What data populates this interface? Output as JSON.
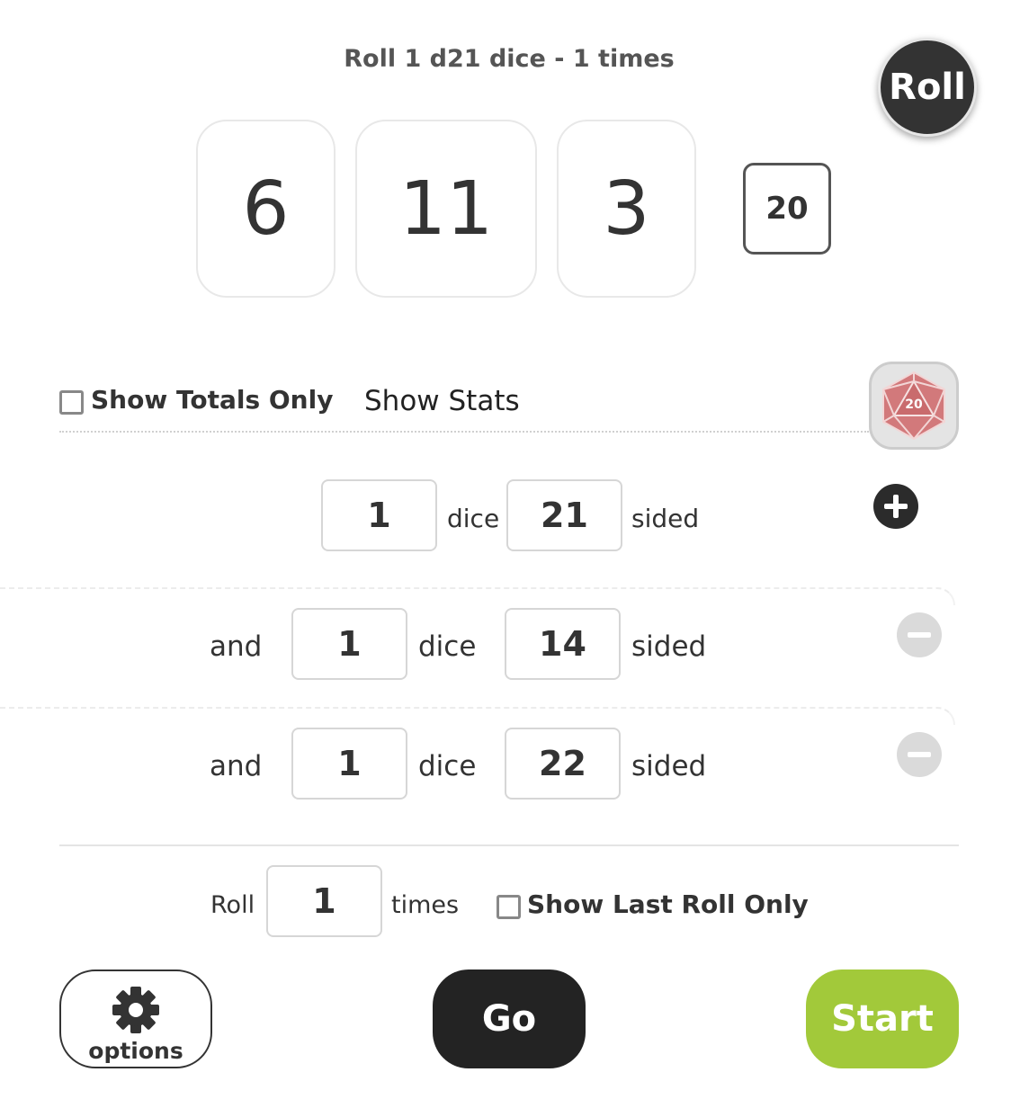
{
  "header": {
    "title": "Roll 1 d21 dice - 1 times",
    "roll_button_label": "Roll"
  },
  "results": {
    "values": [
      "6",
      "11",
      "3"
    ],
    "total": "20"
  },
  "toolbar": {
    "show_totals_only_label": "Show Totals Only",
    "show_totals_only_checked": false,
    "show_stats_label": "Show Stats",
    "dice_icon_number": "20",
    "dice_icon_color": "#d2797b"
  },
  "dice_rows": [
    {
      "prefix": "",
      "count": "1",
      "dice_word": "dice",
      "sides": "21",
      "sided_word": "sided",
      "action": "add"
    },
    {
      "prefix": "and",
      "count": "1",
      "dice_word": "dice",
      "sides": "14",
      "sided_word": "sided",
      "action": "remove"
    },
    {
      "prefix": "and",
      "count": "1",
      "dice_word": "dice",
      "sides": "22",
      "sided_word": "sided",
      "action": "remove"
    }
  ],
  "repeat": {
    "roll_word": "Roll",
    "times_value": "1",
    "times_word": "times",
    "show_last_roll_only_label": "Show Last Roll Only",
    "show_last_roll_only_checked": false
  },
  "footer": {
    "options_label": "options",
    "go_label": "Go",
    "start_label": "Start",
    "start_color": "#a2c93a",
    "go_color": "#232323"
  }
}
